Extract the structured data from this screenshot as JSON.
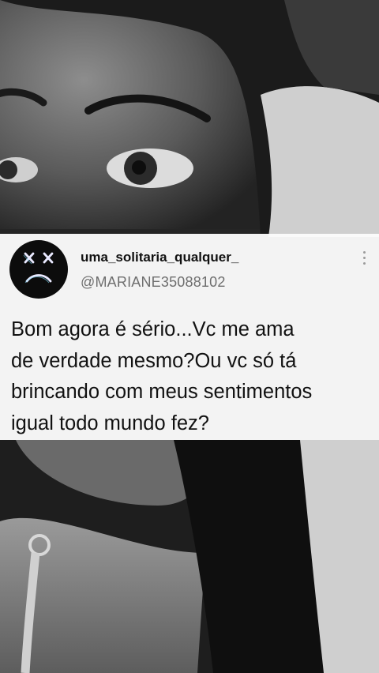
{
  "tweet": {
    "username": "uma_solitaria_qualquer_",
    "handle": "@MARIANE35088102",
    "text_lines": [
      "Bom agora é sério...Vc me ama",
      "de verdade mesmo?Ou vc só tá",
      "brincando com meus sentimentos",
      "igual todo mundo fez?"
    ],
    "avatar_icon": "sad-face-icon",
    "menu_icon": "more-vertical-icon"
  },
  "colors": {
    "card_background": "#fcfcfc",
    "username": "#111111",
    "handle": "#6e6e6e",
    "avatar_bg": "#0c0c0c",
    "avatar_glyph": "#e9e9ff"
  }
}
